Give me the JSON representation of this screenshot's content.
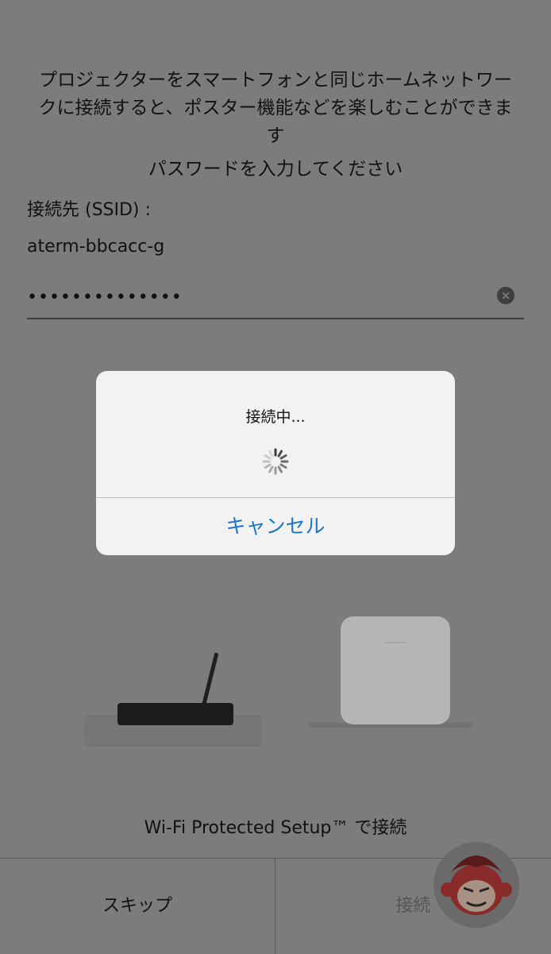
{
  "intro_text": "プロジェクターをスマートフォンと同じホームネットワークに接続すると、ポスター機能などを楽しむことができます",
  "password_prompt": "パスワードを入力してください",
  "ssid": {
    "label": "接続先 (SSID) :",
    "value": "aterm-bbcacc-g"
  },
  "password": {
    "masked_value": "••••••••••••••",
    "clear_icon": "clear-circle-icon"
  },
  "dialog": {
    "title": "接続中...",
    "spinner_icon": "activity-spinner-icon",
    "cancel_label": "キャンセル"
  },
  "illustration": {
    "router_icon": "router-icon",
    "projector_icon": "projector-icon"
  },
  "wps_text": "Wi-Fi Protected Setup™ で接続",
  "bottom_bar": {
    "skip_label": "スキップ",
    "connect_label": "接続"
  },
  "watermark": "monkey-logo",
  "colors": {
    "background_dimmed": "#7c7c7c",
    "dialog_bg": "#f2f2f2",
    "accent": "#1d75c8"
  }
}
